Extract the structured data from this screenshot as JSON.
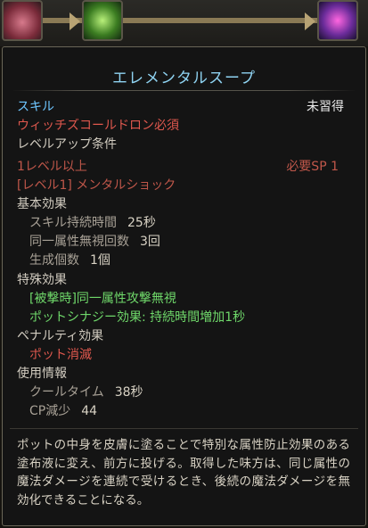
{
  "tooltip": {
    "title": "エレメンタルスープ",
    "skill_label": "スキル",
    "status": "未習得",
    "requirement_item": "ウィッチズコールドロン必須",
    "levelup_heading": "レベルアップ条件",
    "level_req": "1レベル以上",
    "sp_req": "必要SP 1",
    "prereq_skill": "[レベル1] メンタルショック",
    "basic_effects": {
      "heading": "基本効果",
      "items": [
        {
          "label": "スキル持続時間",
          "value": "25秒"
        },
        {
          "label": "同一属性無視回数",
          "value": "3回"
        },
        {
          "label": "生成個数",
          "value": "1個"
        }
      ]
    },
    "special_effects": {
      "heading": "特殊効果",
      "items": [
        "[被撃時]同一属性攻撃無視",
        "ポットシナジー効果: 持続時間増加1秒"
      ]
    },
    "penalty": {
      "heading": "ペナルティ効果",
      "items": [
        "ポット消滅"
      ]
    },
    "usage": {
      "heading": "使用情報",
      "items": [
        {
          "label": "クールタイム",
          "value": "38秒"
        },
        {
          "label": "CP減少",
          "value": "44"
        }
      ]
    },
    "description": "ポットの中身を皮膚に塗ることで特別な属性防止効果のある塗布液に変え、前方に投げる。取得した味方は、同じ属性の魔法ダメージを連続で受けるとき、後続の魔法ダメージを無効化できることになる。"
  },
  "colors": {
    "title": "#8fd3f2",
    "skill_label": "#6ec6ff",
    "requirement": "#e0584e",
    "effect_green": "#6fd86a"
  },
  "background_icons": [
    "cake-skill-icon",
    "spider-skill-icon",
    "crystal-skill-icon"
  ]
}
